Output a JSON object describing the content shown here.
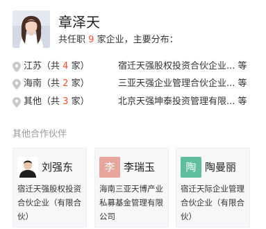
{
  "person": {
    "name": "章泽天",
    "summary_prefix": "共任职",
    "company_count": "9",
    "summary_suffix": "家企业，主要分布："
  },
  "regions": [
    {
      "name": "江苏（共",
      "count": "4",
      "unit": "家）",
      "company": "宿迁天强股权投资合伙企业... 等"
    },
    {
      "name": "海南（共",
      "count": "2",
      "unit": "家）",
      "company": "三亚天强企业管理合伙企业... 等"
    },
    {
      "name": "其他（共",
      "count": "3",
      "unit": "家）",
      "company": "北京天强坤泰投资管理有限... 等"
    }
  ],
  "partners": {
    "title": "其他合作伙伴",
    "items": [
      {
        "name": "刘强东",
        "avatar_text": "",
        "avatar_color": "#2b2b2b",
        "company": "宿迁天强股权投资合伙企业（有限合伙）"
      },
      {
        "name": "李瑞玉",
        "avatar_text": "李",
        "avatar_color": "#e8a59b",
        "company": "海南三亚天博产业私募基金管理有限公司"
      },
      {
        "name": "陶曼丽",
        "avatar_text": "陶",
        "avatar_color": "#5dbf9c",
        "company": "宿迁天际企业管理合伙企业（有限合伙）"
      }
    ]
  },
  "icons": {
    "region_pin": "location-pin-icon"
  },
  "colors": {
    "highlight": "#fb4e2c",
    "muted": "#999999",
    "pin": "#c8c8c8"
  }
}
